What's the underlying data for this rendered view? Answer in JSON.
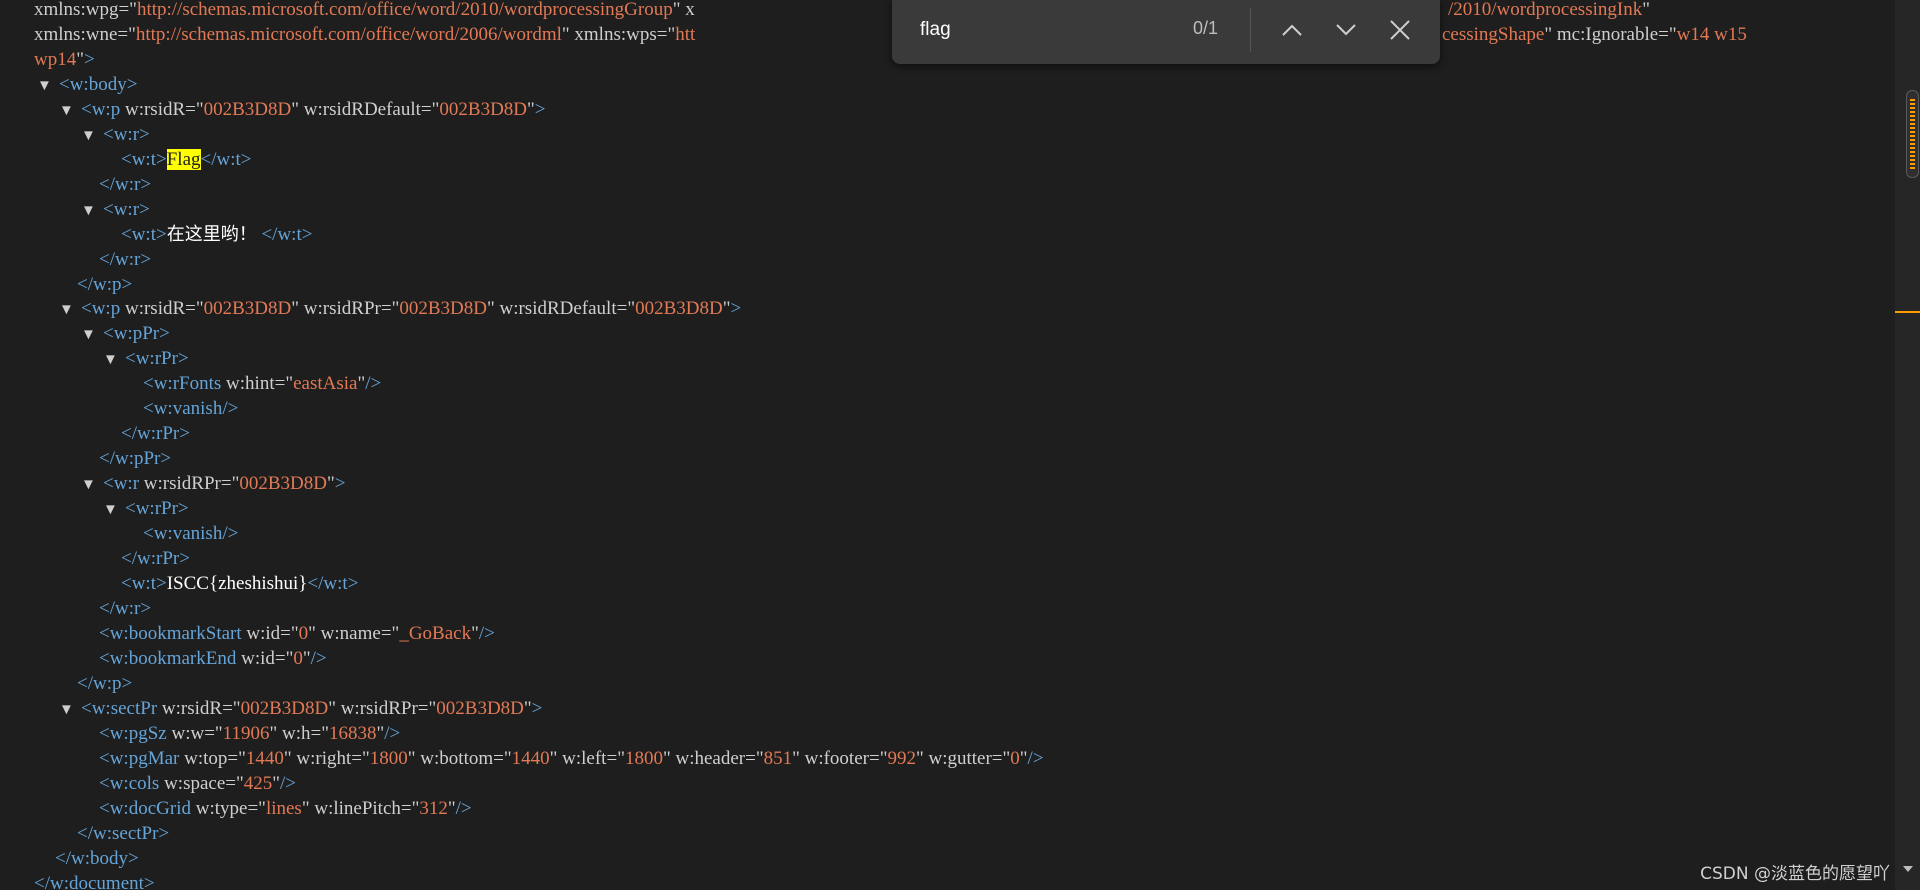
{
  "find_bar": {
    "query": "flag",
    "match_count": "0/1"
  },
  "watermark": "CSDN @淡蓝色的愿望吖",
  "code": {
    "ns_wpg": "http://schemas.microsoft.com/office/word/2010/wordprocessingGroup",
    "ns_wpi_tail": "/2010/wordprocessingInk",
    "ns_wne": "http://schemas.microsoft.com/office/word/2006/wordml",
    "ns_wps_head": "htt",
    "shape_tail": "cessingShape",
    "ignorable": "w14 w15 wp14",
    "rsid": "002B3D8D",
    "text1": "Flag",
    "text2": "在这里哟！",
    "hint": "eastAsia",
    "flag_text": "ISCC{zheshishui}",
    "bookmark_id": "0",
    "bookmark_name": "_GoBack",
    "pg_w": "11906",
    "pg_h": "16838",
    "mar_top": "1440",
    "mar_right": "1800",
    "mar_bottom": "1440",
    "mar_left": "1800",
    "mar_header": "851",
    "mar_footer": "992",
    "mar_gutter": "0",
    "cols_space": "425",
    "grid_type": "lines",
    "line_pitch": "312"
  },
  "icons": {
    "collapse": "triangle-down-icon",
    "prev": "chevron-up-icon",
    "next": "chevron-down-icon",
    "close": "close-icon"
  }
}
